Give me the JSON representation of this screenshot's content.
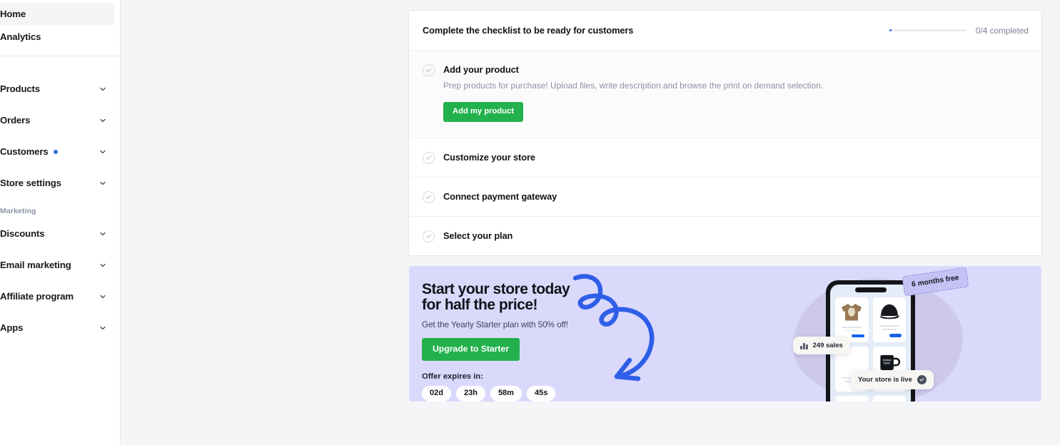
{
  "sidebar": {
    "top_items": [
      {
        "label": "Home",
        "active": true,
        "chevron": false,
        "dot": false
      },
      {
        "label": "Analytics",
        "active": false,
        "chevron": false,
        "dot": false
      }
    ],
    "main_items": [
      {
        "label": "Products",
        "active": false,
        "chevron": true,
        "dot": false
      },
      {
        "label": "Orders",
        "active": false,
        "chevron": true,
        "dot": false
      },
      {
        "label": "Customers",
        "active": false,
        "chevron": true,
        "dot": true
      },
      {
        "label": "Store settings",
        "active": false,
        "chevron": true,
        "dot": false
      }
    ],
    "section_header": "Marketing",
    "marketing_items": [
      {
        "label": "Discounts",
        "active": false,
        "chevron": true,
        "dot": false
      },
      {
        "label": "Email marketing",
        "active": false,
        "chevron": true,
        "dot": false
      },
      {
        "label": "Affiliate program",
        "active": false,
        "chevron": true,
        "dot": false
      },
      {
        "label": "Apps",
        "active": false,
        "chevron": true,
        "dot": false
      }
    ],
    "accent_dot_color": "#2f6fe4"
  },
  "checklist": {
    "title": "Complete the checklist to be ready for customers",
    "progress_label": "0/4 completed",
    "progress_percent": 0,
    "progress_color": "#2f6fe4",
    "items": [
      {
        "title": "Add your product",
        "description": "Prep products for purchase! Upload files, write description and browse the print on demand selection.",
        "button": "Add my product",
        "expanded": true,
        "completed": false
      },
      {
        "title": "Customize your store",
        "description": "",
        "button": "",
        "expanded": false,
        "completed": false
      },
      {
        "title": "Connect payment gateway",
        "description": "",
        "button": "",
        "expanded": false,
        "completed": false
      },
      {
        "title": "Select your plan",
        "description": "",
        "button": "",
        "expanded": false,
        "completed": false
      }
    ]
  },
  "promo": {
    "heading_line1": "Start your store today",
    "heading_line2": "for half the price!",
    "subtitle": "Get the Yearly Starter plan with 50% off!",
    "button": "Upgrade to Starter",
    "expires_label": "Offer expires in:",
    "countdown": [
      "02d",
      "23h",
      "58m",
      "45s"
    ],
    "badge": "6 months free",
    "tip_sales": "249 sales",
    "tip_live": "Your store is live",
    "bg_color": "#dbd9fb",
    "accent_color": "#23b14d",
    "doodle_color": "#2f5fe8"
  }
}
